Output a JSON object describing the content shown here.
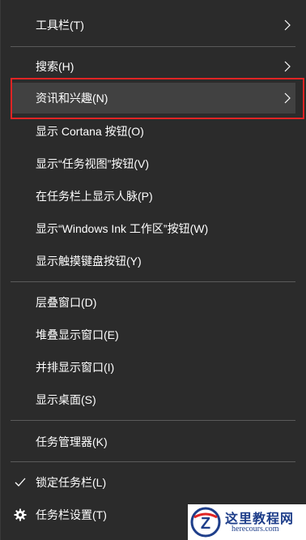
{
  "menu": {
    "items": [
      {
        "label": "工具栏(T)",
        "submenu": true
      },
      {
        "label": "搜索(H)",
        "submenu": true
      },
      {
        "label": "资讯和兴趣(N)",
        "submenu": true,
        "highlighted": true
      },
      {
        "label": "显示 Cortana 按钮(O)"
      },
      {
        "label": "显示“任务视图”按钮(V)"
      },
      {
        "label": "在任务栏上显示人脉(P)"
      },
      {
        "label": "显示“Windows Ink 工作区”按钮(W)"
      },
      {
        "label": "显示触摸键盘按钮(Y)"
      },
      {
        "label": "层叠窗口(D)"
      },
      {
        "label": "堆叠显示窗口(E)"
      },
      {
        "label": "并排显示窗口(I)"
      },
      {
        "label": "显示桌面(S)"
      },
      {
        "label": "任务管理器(K)"
      },
      {
        "label": "锁定任务栏(L)",
        "checked": true
      },
      {
        "label": "任务栏设置(T)",
        "icon": "gear-icon"
      }
    ]
  },
  "watermark": {
    "title": "这里教程网",
    "url": "herecours.com",
    "logo_letter": "Z"
  },
  "colors": {
    "menu_background": "#2b2b2b",
    "highlight_background": "#414141",
    "highlight_border": "#e02424",
    "text": "#ffffff",
    "watermark_text": "#1e3e8a"
  }
}
